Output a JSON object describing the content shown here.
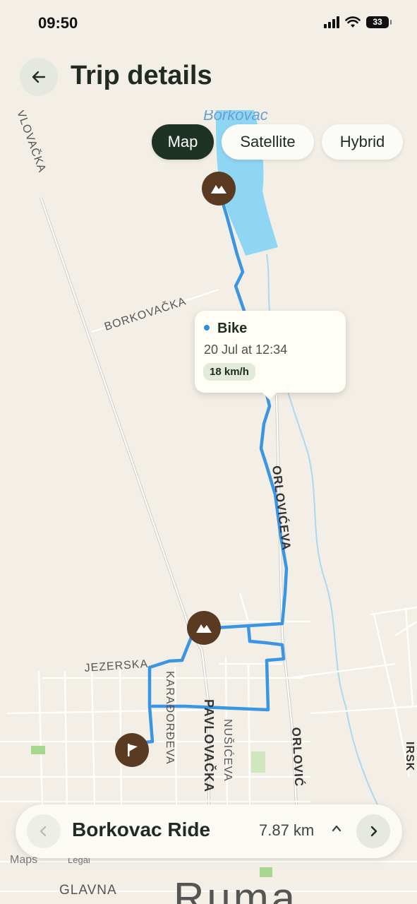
{
  "status_bar": {
    "time": "09:50",
    "battery": "33"
  },
  "header": {
    "title": "Trip details"
  },
  "map_tabs": [
    {
      "label": "Map",
      "selected": true
    },
    {
      "label": "Satellite",
      "selected": false
    },
    {
      "label": "Hybrid",
      "selected": false
    }
  ],
  "map": {
    "labels": {
      "borkovac": "Borkovac",
      "vlovacka": "VLOVAČKA",
      "borkovacka": "BORKOVAČKA",
      "orloviceva": "ORLOVIĆEVA",
      "orlovic_bottom": "ORLOVIĆ",
      "jezerska": "JEZERSKA",
      "karadjordjeva": "KARAĐORĐEVA",
      "pavlovacka": "PAVLOVAČKA",
      "nusiceva": "NUŠIĆEVA",
      "irsk": "IRSK",
      "glavna": "GLAVNA",
      "ruma": "Ruma",
      "maps_credit": "Maps",
      "legal": "Legal"
    },
    "route_color": "#3a95e3",
    "water_color": "#8fd6f4"
  },
  "popup": {
    "title": "Bike",
    "date": "20 Jul at 12:34",
    "speed": "18 km/h"
  },
  "bottom_bar": {
    "name": "Borkovac Ride",
    "distance": "7.87 km"
  }
}
